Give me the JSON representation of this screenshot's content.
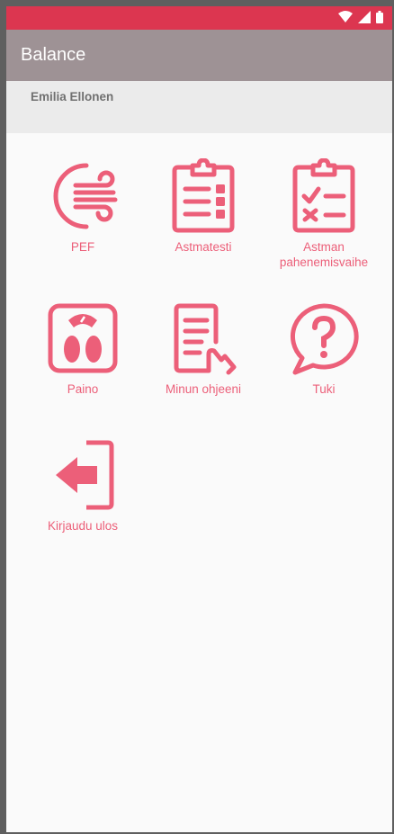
{
  "app": {
    "title": "Balance"
  },
  "user": {
    "name": "Emilia Ellonen"
  },
  "colors": {
    "statusbar": "#dc3650",
    "appbar": "#9e9295",
    "accent": "#ec5f79"
  },
  "status_icons": [
    "wifi-icon",
    "signal-icon",
    "battery-icon"
  ],
  "menu": [
    {
      "label": "PEF",
      "icon": "wind-icon"
    },
    {
      "label": "Astmatesti",
      "icon": "clipboard-list-icon"
    },
    {
      "label": "Astman pahenemisvaihe",
      "icon": "clipboard-check-icon"
    },
    {
      "label": "Paino",
      "icon": "scale-icon"
    },
    {
      "label": "Minun ohjeeni",
      "icon": "document-hand-icon"
    },
    {
      "label": "Tuki",
      "icon": "help-bubble-icon"
    },
    {
      "label": "Kirjaudu ulos",
      "icon": "logout-icon"
    }
  ]
}
